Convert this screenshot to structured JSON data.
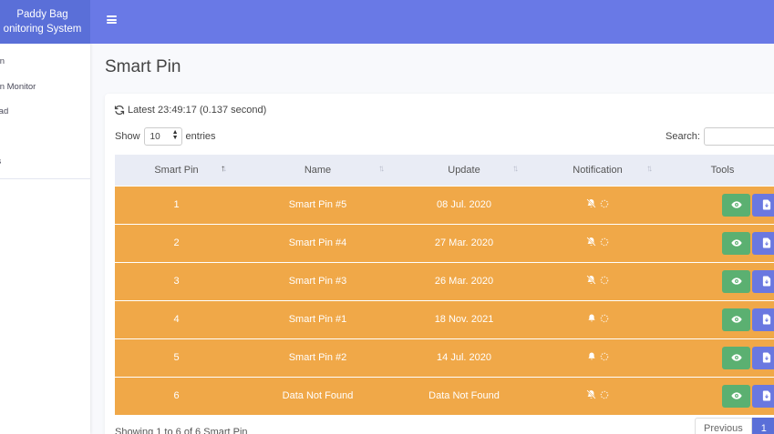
{
  "sidebar": {
    "brand_line1": "Paddy Bag",
    "brand_line2": "onitoring System",
    "items": [
      {
        "label": "t Pin"
      },
      {
        "label": "t Pin Monitor"
      },
      {
        "label": "nload"
      },
      {
        "label": "ub"
      },
      {
        "label": "t us"
      }
    ]
  },
  "page": {
    "title": "Smart Pin"
  },
  "toolbar": {
    "latest": "Latest 23:49:17 (0.137 second)",
    "show_label": "Show",
    "entries_value": "10",
    "entries_label": "entries",
    "search_label": "Search:"
  },
  "table": {
    "headers": [
      "Smart Pin",
      "Name",
      "Update",
      "Notification",
      "Tools"
    ],
    "rows": [
      {
        "pin": "1",
        "name": "Smart Pin #5",
        "update": "08 Jul. 2020",
        "notif": "bell-slash"
      },
      {
        "pin": "2",
        "name": "Smart Pin #4",
        "update": "27 Mar. 2020",
        "notif": "bell-slash"
      },
      {
        "pin": "3",
        "name": "Smart Pin #3",
        "update": "26 Mar. 2020",
        "notif": "bell-slash"
      },
      {
        "pin": "4",
        "name": "Smart Pin #1",
        "update": "18 Nov. 2021",
        "notif": "bell"
      },
      {
        "pin": "5",
        "name": "Smart Pin #2",
        "update": "14 Jul. 2020",
        "notif": "bell"
      },
      {
        "pin": "6",
        "name": "Data Not Found",
        "update": "Data Not Found",
        "notif": "bell-slash"
      }
    ]
  },
  "footer": {
    "info": "Showing 1 to 6 of 6 Smart Pin",
    "previous": "Previous",
    "page": "1"
  },
  "colors": {
    "topbar": "#6979e6",
    "brand": "#5a6fd8",
    "row": "#f0a848",
    "view_button": "#5bb071",
    "download_button": "#6a78e0"
  }
}
